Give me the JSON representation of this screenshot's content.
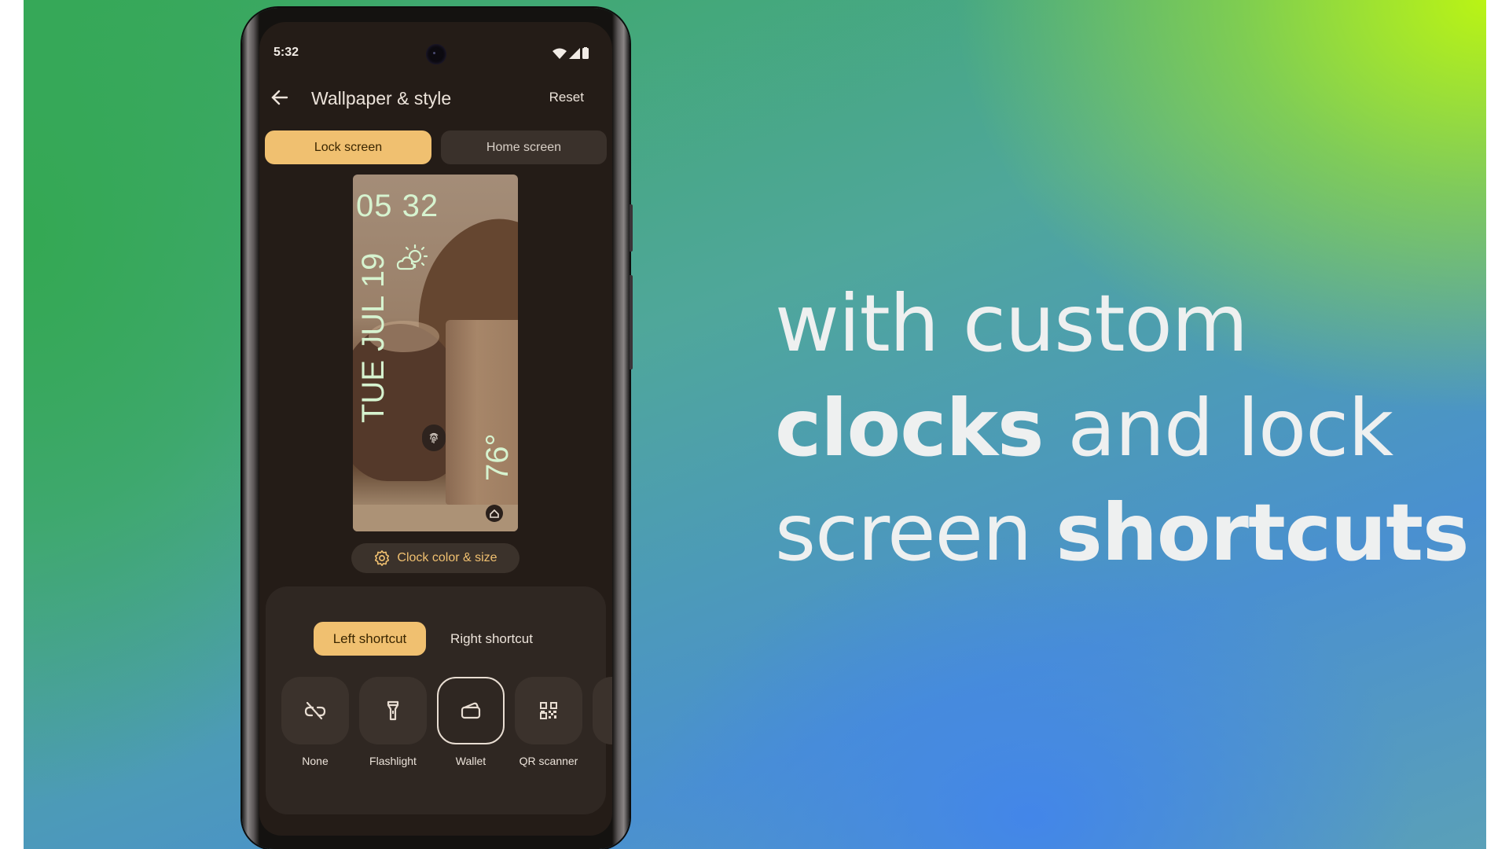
{
  "status_bar": {
    "time": "5:32",
    "icons": [
      "wifi-icon",
      "cellular-signal-icon",
      "battery-icon"
    ]
  },
  "app_bar": {
    "back_icon": "arrow-back-icon",
    "title": "Wallpaper & style",
    "action": "Reset"
  },
  "tabs": [
    {
      "label": "Lock screen",
      "selected": true
    },
    {
      "label": "Home screen",
      "selected": false
    }
  ],
  "preview": {
    "clock_time": "05 32",
    "date": "TUE JUL 19",
    "temperature": "76°",
    "weather_icon": "partly-cloudy-icon",
    "left_shortcut_icon": "fingerprint-icon",
    "right_shortcut_icon": "home-icon"
  },
  "clock_button": {
    "icon": "gear-icon",
    "label": "Clock color & size"
  },
  "shortcut_tabs": [
    {
      "label": "Left shortcut",
      "selected": true
    },
    {
      "label": "Right shortcut",
      "selected": false
    }
  ],
  "shortcuts": [
    {
      "label": "None",
      "icon": "link-off-icon",
      "selected": false
    },
    {
      "label": "Flashlight",
      "icon": "flashlight-icon",
      "selected": false
    },
    {
      "label": "Wallet",
      "icon": "wallet-icon",
      "selected": true
    },
    {
      "label": "QR scanner",
      "icon": "qr-code-icon",
      "selected": false
    }
  ],
  "headline": {
    "line1": [
      {
        "text": "with custom",
        "weight": "light"
      }
    ],
    "line2": [
      {
        "text": "clocks",
        "weight": "bold"
      },
      {
        "text": " and lock",
        "weight": "light"
      }
    ],
    "line3": [
      {
        "text": "screen ",
        "weight": "light"
      },
      {
        "text": "shortcuts",
        "weight": "bold"
      }
    ]
  },
  "colors": {
    "accent": "#f0c070",
    "screen_bg": "#241c17",
    "clock_color": "#d6f3cf",
    "headline_color": "#eef0f0"
  }
}
